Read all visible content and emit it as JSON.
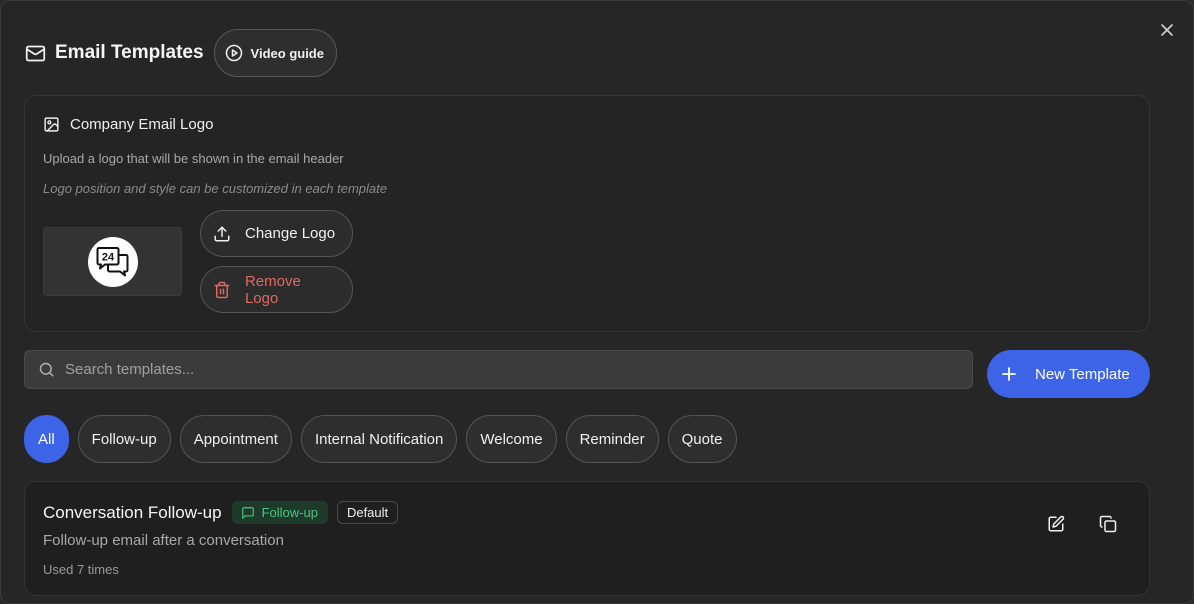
{
  "header": {
    "title": "Email Templates",
    "video_guide_label": "Video guide"
  },
  "logo_section": {
    "title": "Company Email Logo",
    "description": "Upload a logo that will be shown in the email header",
    "hint": "Logo position and style can be customized in each template",
    "logo_text": "24",
    "change_label": "Change Logo",
    "remove_label": "Remove Logo"
  },
  "search": {
    "placeholder": "Search templates...",
    "value": ""
  },
  "new_template_label": "New Template",
  "filters": [
    "All",
    "Follow-up",
    "Appointment",
    "Internal Notification",
    "Welcome",
    "Reminder",
    "Quote"
  ],
  "active_filter": "All",
  "templates": [
    {
      "name": "Conversation Follow-up",
      "category": "Follow-up",
      "default_label": "Default",
      "description": "Follow-up email after a conversation",
      "usage": "Used 7 times"
    }
  ],
  "colors": {
    "accent": "#3d63e6",
    "danger": "#e06a5e",
    "category_green": "#4cc37f"
  }
}
